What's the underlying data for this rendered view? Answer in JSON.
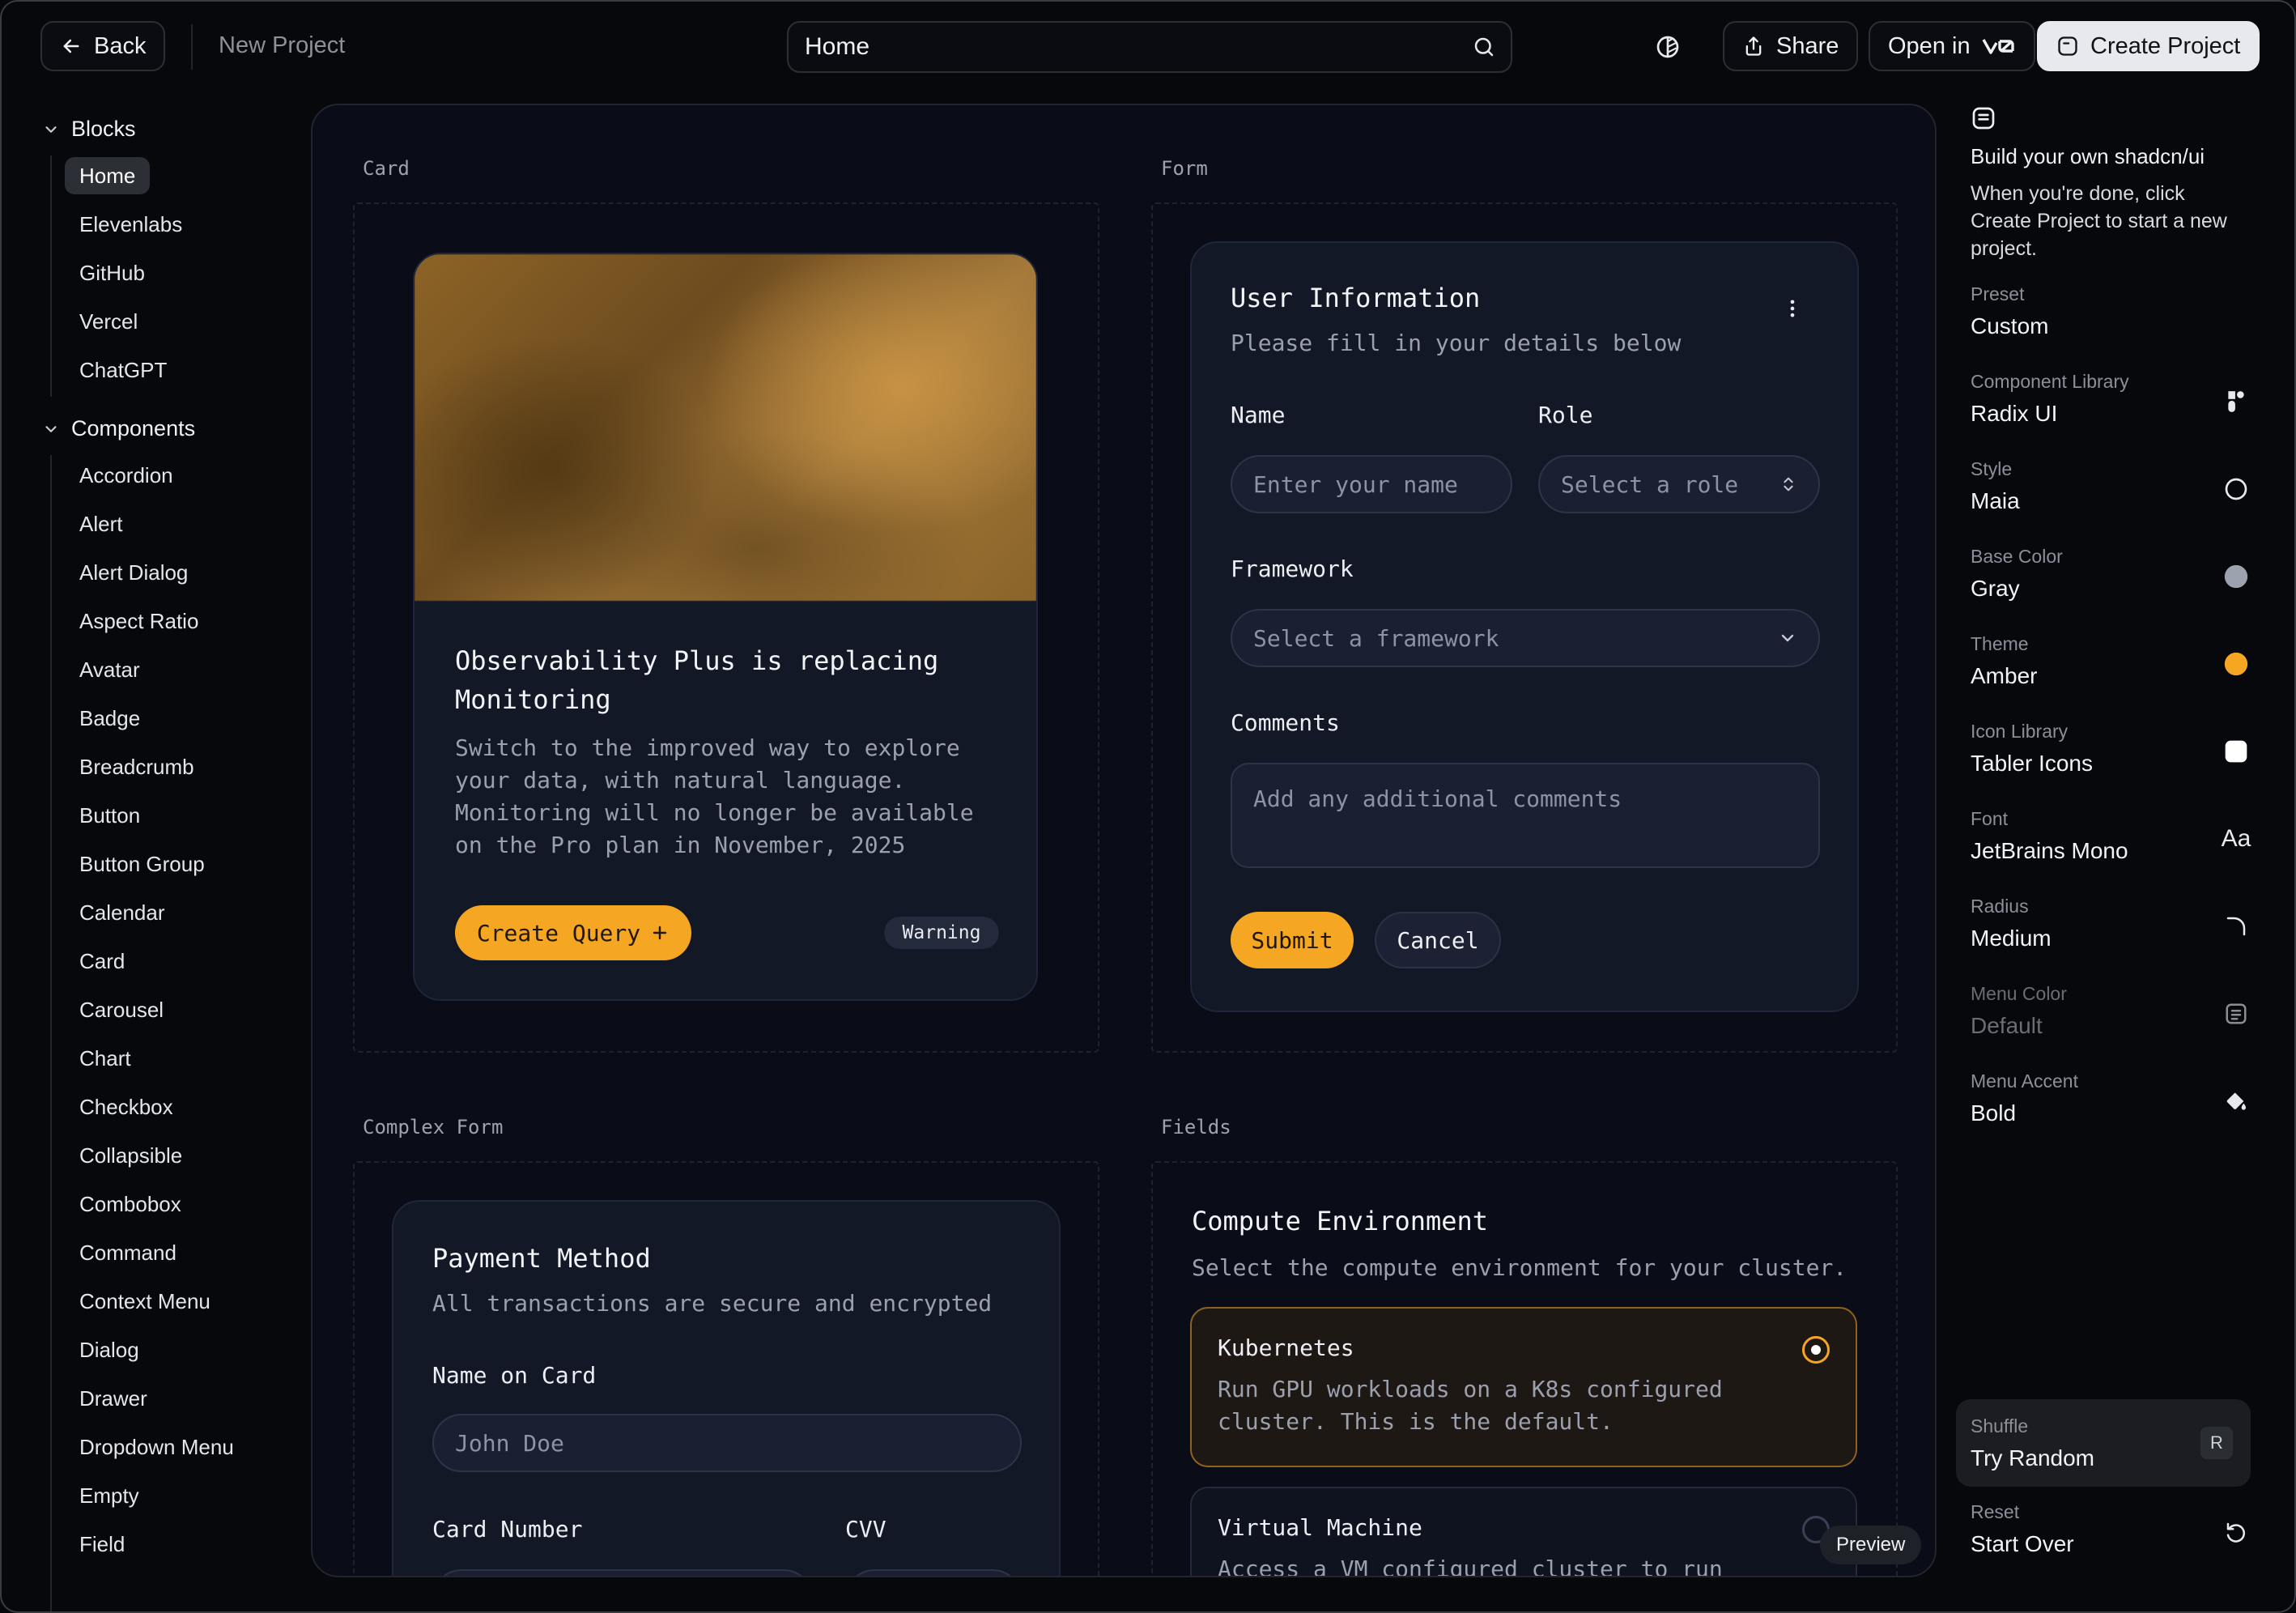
{
  "topbar": {
    "back_label": "Back",
    "project_name": "New Project",
    "search_value": "Home",
    "share_label": "Share",
    "open_in_label": "Open in",
    "create_label": "Create Project"
  },
  "sidebar": {
    "blocks_title": "Blocks",
    "blocks": [
      "Home",
      "Elevenlabs",
      "GitHub",
      "Vercel",
      "ChatGPT"
    ],
    "components_title": "Components",
    "components": [
      "Accordion",
      "Alert",
      "Alert Dialog",
      "Aspect Ratio",
      "Avatar",
      "Badge",
      "Breadcrumb",
      "Button",
      "Button Group",
      "Calendar",
      "Card",
      "Carousel",
      "Chart",
      "Checkbox",
      "Collapsible",
      "Combobox",
      "Command",
      "Context Menu",
      "Dialog",
      "Drawer",
      "Dropdown Menu",
      "Empty",
      "Field"
    ]
  },
  "sections": {
    "card": "Card",
    "form": "Form",
    "complex_form": "Complex Form",
    "fields": "Fields"
  },
  "card_block": {
    "title_line1": "Observability Plus is replacing",
    "title_line2": "Monitoring",
    "desc": [
      "Switch to the improved way to explore",
      "your data, with natural language.",
      "Monitoring will no longer be available",
      "on the Pro plan in November, 2025"
    ],
    "button": "Create Query",
    "badge": "Warning"
  },
  "form_block": {
    "title": "User Information",
    "subtitle": "Please fill in your details below",
    "name_label": "Name",
    "name_placeholder": "Enter your name",
    "role_label": "Role",
    "role_placeholder": "Select a role",
    "framework_label": "Framework",
    "framework_placeholder": "Select a framework",
    "comments_label": "Comments",
    "comments_placeholder": "Add any additional comments",
    "submit": "Submit",
    "cancel": "Cancel"
  },
  "complex_form": {
    "title": "Payment Method",
    "subtitle": "All transactions are secure and encrypted",
    "name_label": "Name on Card",
    "name_placeholder": "John Doe",
    "card_number_label": "Card Number",
    "cvv_label": "CVV"
  },
  "fields_block": {
    "title": "Compute Environment",
    "subtitle": "Select the compute environment for your cluster.",
    "opt1_title": "Kubernetes",
    "opt1_desc1": "Run GPU workloads on a K8s configured",
    "opt1_desc2": "cluster. This is the default.",
    "opt2_title": "Virtual Machine",
    "opt2_desc1": "Access a VM configured cluster to run"
  },
  "preview_label": "Preview",
  "right": {
    "intro_title": "Build your own shadcn/ui",
    "intro_body": "When you're done, click Create Project to start a new project.",
    "options": [
      {
        "label": "Preset",
        "value": "Custom",
        "icon": "none"
      },
      {
        "label": "Component Library",
        "value": "Radix UI",
        "icon": "radix-icon"
      },
      {
        "label": "Style",
        "value": "Maia",
        "icon": "circle-outline-icon"
      },
      {
        "label": "Base Color",
        "value": "Gray",
        "icon": "gray-dot-icon"
      },
      {
        "label": "Theme",
        "value": "Amber",
        "icon": "amber-dot-icon"
      },
      {
        "label": "Icon Library",
        "value": "Tabler Icons",
        "icon": "square-icon"
      },
      {
        "label": "Font",
        "value": "JetBrains Mono",
        "icon": "font-aa-icon"
      },
      {
        "label": "Radius",
        "value": "Medium",
        "icon": "radius-corner-icon"
      },
      {
        "label": "Menu Color",
        "value": "Default",
        "icon": "menu-icon"
      },
      {
        "label": "Menu Accent",
        "value": "Bold",
        "icon": "paint-bucket-icon"
      }
    ],
    "font_icon_text": "Aa",
    "shuffle_label": "Shuffle",
    "shuffle_value": "Try Random",
    "shuffle_key": "R",
    "reset_label": "Reset",
    "reset_value": "Start Over"
  },
  "colors": {
    "accent": "#f5a623",
    "background": "#07080c",
    "panel": "#0a0d17",
    "card": "#131827",
    "gray_swatch": "#9ca3af"
  }
}
